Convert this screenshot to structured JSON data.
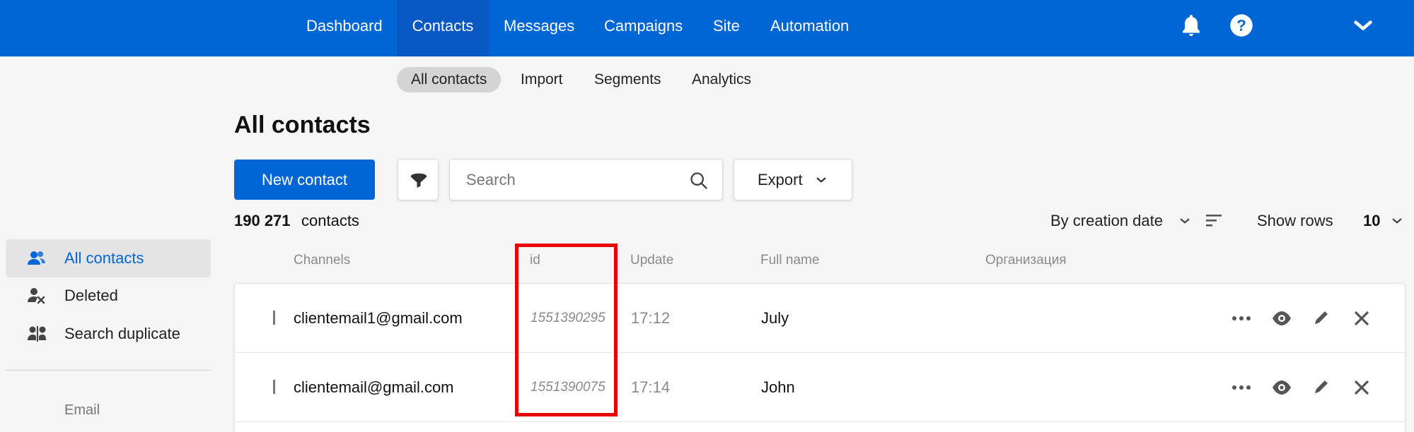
{
  "topnav": {
    "items": [
      "Dashboard",
      "Contacts",
      "Messages",
      "Campaigns",
      "Site",
      "Automation"
    ],
    "active_index": 1
  },
  "topbar_icons": [
    "bell-icon",
    "help-icon",
    "chevron-down-icon"
  ],
  "subnav": {
    "items": [
      "All contacts",
      "Import",
      "Segments",
      "Analytics"
    ],
    "active_index": 0
  },
  "page": {
    "title": "All contacts"
  },
  "toolbar": {
    "new_contact_label": "New contact",
    "search_placeholder": "Search",
    "search_value": "",
    "export_label": "Export"
  },
  "summary": {
    "count": "190 271",
    "count_suffix": "contacts"
  },
  "sort": {
    "label": "By creation date",
    "show_rows_label": "Show rows",
    "rows_value": "10"
  },
  "sidebar": {
    "items": [
      {
        "label": "All contacts",
        "icon": "users-icon",
        "active": true
      },
      {
        "label": "Deleted",
        "icon": "user-deleted-icon",
        "active": false
      },
      {
        "label": "Search duplicate",
        "icon": "duplicate-users-icon",
        "active": false
      }
    ],
    "group_label": "Email"
  },
  "table": {
    "columns": [
      "Channels",
      "id",
      "Update",
      "Full name",
      "Организация"
    ],
    "rows": [
      {
        "email": "clientemail1@gmail.com",
        "id": "1551390295",
        "update": "17:12",
        "full_name": "July",
        "organization": ""
      },
      {
        "email": "clientemail@gmail.com",
        "id": "1551390075",
        "update": "17:14",
        "full_name": "John",
        "organization": ""
      }
    ],
    "row_actions": [
      "more-icon",
      "view-icon",
      "edit-icon",
      "delete-icon"
    ]
  },
  "colors": {
    "brand_blue": "#0066d6",
    "nav_active": "#0a58c4",
    "highlight_red": "#e60000"
  }
}
